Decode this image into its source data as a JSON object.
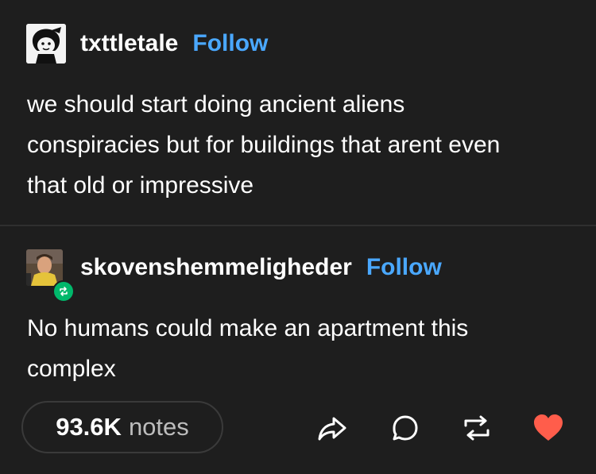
{
  "posts": [
    {
      "username": "txttletale",
      "follow_label": "Follow",
      "text": "we should start doing ancient aliens\nconspiracies but for buildings that arent even\nthat old or impressive"
    },
    {
      "username": "skovenshemmeligheder",
      "follow_label": "Follow",
      "text": "No humans could make an apartment this\ncomplex"
    }
  ],
  "footer": {
    "notes_count": "93.6K",
    "notes_label": "notes",
    "actions": [
      "share-icon",
      "reply-icon",
      "reblog-icon",
      "like-icon"
    ]
  },
  "colors": {
    "background": "#1e1e1e",
    "follow": "#4aa8ff",
    "like": "#ff5d4b",
    "reblog_badge": "#00b86b"
  }
}
